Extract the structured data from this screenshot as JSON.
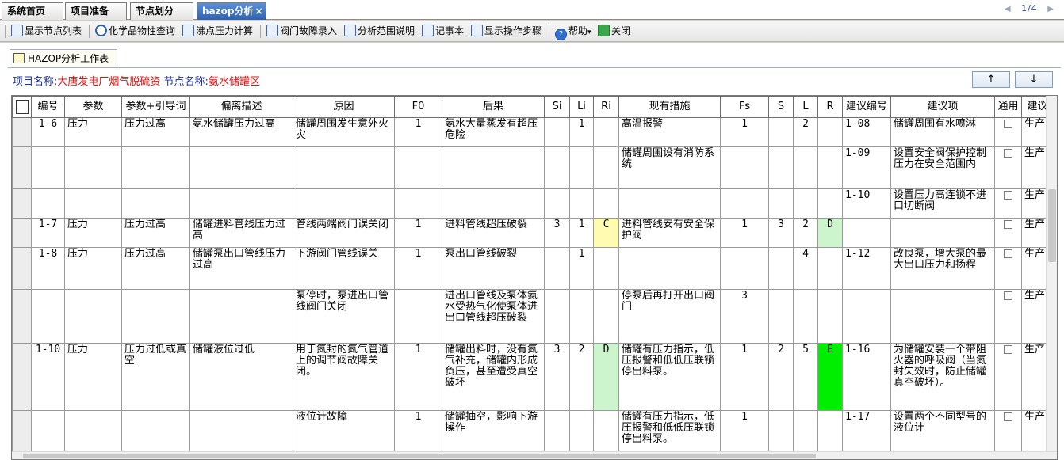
{
  "top_tabs": [
    {
      "label": "系统首页"
    },
    {
      "label": "项目准备"
    },
    {
      "label": "节点划分"
    },
    {
      "label": "hazop分析",
      "close": "×"
    }
  ],
  "pager": {
    "text": "1/4",
    "prev": "◀",
    "next": "▶"
  },
  "toolbar": {
    "show_node_list": "显示节点列表",
    "chem_props": "化学品物性查询",
    "boiling_calc": "沸点压力计算",
    "valve_fault": "阀门故障录入",
    "scope_desc": "分析范围说明",
    "notepad": "记事本",
    "show_steps": "显示操作步骤",
    "help": "帮助",
    "help_caret": "▾",
    "close": "关闭"
  },
  "work_tab": {
    "label": "HAZOP分析工作表"
  },
  "project": {
    "name_label": "项目名称:",
    "name_value": "大唐发电厂烟气脱硫资",
    "node_label": "节点名称:",
    "node_value": "氨水储罐区"
  },
  "nav": {
    "up": "↑",
    "down": "↓"
  },
  "columns": [
    "编号",
    "参数",
    "参数+引导词",
    "偏离描述",
    "原因",
    "F0",
    "后果",
    "Si",
    "Li",
    "Ri",
    "现有措施",
    "Fs",
    "S",
    "L",
    "R",
    "建议编号",
    "建议项",
    "通用",
    "建议"
  ],
  "rows": [
    {
      "id": "1-6",
      "param": "压力",
      "guide": "压力过高",
      "dev": "氨水储罐压力过高",
      "cause": "储罐周围发生意外火灾",
      "f0": "1",
      "cons": "氨水大量蒸发有超压危险",
      "si": "",
      "li": "1",
      "ri": "",
      "meas": "高温报警",
      "fs": "1",
      "s": "",
      "l": "2",
      "r": "",
      "sid": "1-08",
      "sug": "储罐周围有水喷淋",
      "owner": "生产"
    },
    {
      "id": "",
      "param": "",
      "guide": "",
      "dev": "",
      "cause": "",
      "f0": "",
      "cons": "",
      "si": "",
      "li": "",
      "ri": "",
      "meas": "储罐周围设有消防系统",
      "fs": "",
      "s": "",
      "l": "",
      "r": "",
      "sid": "1-09",
      "sug": "设置安全阀保护控制压力在安全范围内",
      "owner": "生产"
    },
    {
      "id": "",
      "param": "",
      "guide": "",
      "dev": "",
      "cause": "",
      "f0": "",
      "cons": "",
      "si": "",
      "li": "",
      "ri": "",
      "meas": "",
      "fs": "",
      "s": "",
      "l": "",
      "r": "",
      "sid": "1-10",
      "sug": "设置压力高连锁不进口切断阀",
      "owner": "生产"
    },
    {
      "id": "1-7",
      "param": "压力",
      "guide": "压力过高",
      "dev": "储罐进料管线压力过高",
      "cause": "管线两端阀门误关闭",
      "f0": "1",
      "cons": "进料管线超压破裂",
      "si": "3",
      "li": "1",
      "ri": "C",
      "meas": "进料管线安有安全保护阀",
      "fs": "1",
      "s": "3",
      "l": "2",
      "r": "D",
      "sid": "",
      "sug": "",
      "owner": "生产"
    },
    {
      "id": "1-8",
      "param": "压力",
      "guide": "压力过高",
      "dev": "储罐泵出口管线压力过高",
      "cause": "下游阀门管线误关",
      "f0": "1",
      "cons": "泵出口管线破裂",
      "si": "",
      "li": "1",
      "ri": "",
      "meas": "",
      "fs": "",
      "s": "",
      "l": "4",
      "r": "",
      "sid": "1-12",
      "sug": "改良泵，增大泵的最大出口压力和扬程",
      "owner": "生产"
    },
    {
      "id": "",
      "param": "",
      "guide": "",
      "dev": "",
      "cause": "泵停时，泵进出口管线阀门关闭",
      "f0": "",
      "cons": "进出口管线及泵体氨水受热气化使泵体进出口管线超压破裂",
      "si": "",
      "li": "",
      "ri": "",
      "meas": "停泵后再打开出口阀门",
      "fs": "3",
      "s": "",
      "l": "",
      "r": "",
      "sid": "",
      "sug": "",
      "owner": "生产"
    },
    {
      "id": "1-10",
      "param": "压力",
      "guide": "压力过低或真空",
      "dev": "储罐液位过低",
      "cause": "用于氮封的氮气管道上的调节阀故障关闭。",
      "f0": "1",
      "cons": "储罐出料时，没有氮气补充，储罐内形成负压，甚至遭受真空破坏",
      "si": "3",
      "li": "2",
      "ri": "D",
      "meas": "储罐有压力指示，低压报警和低低压联锁停出料泵。",
      "fs": "1",
      "s": "2",
      "l": "5",
      "r": "E",
      "sid": "1-16",
      "sug": "为储罐安装一个带阻火器的呼吸阀（当氮封失效时，防止储罐真空破坏）。",
      "owner": "生产"
    },
    {
      "id": "",
      "param": "",
      "guide": "",
      "dev": "",
      "cause": "液位计故障",
      "f0": "1",
      "cons": "储罐抽空，影响下游操作",
      "si": "",
      "li": "",
      "ri": "",
      "meas": "储罐有压力指示，低压报警和低低压联锁停出料泵。",
      "fs": "1",
      "s": "",
      "l": "",
      "r": "",
      "sid": "1-17",
      "sug": "设置两个不同型号的液位计",
      "owner": "生产"
    }
  ],
  "colors": {
    "ri_C": "#fffcb0",
    "ri_D": "#cdf5cd",
    "r_E": "#00ee00",
    "label_blue": "#1c2fa0",
    "value_red": "#e01010"
  }
}
